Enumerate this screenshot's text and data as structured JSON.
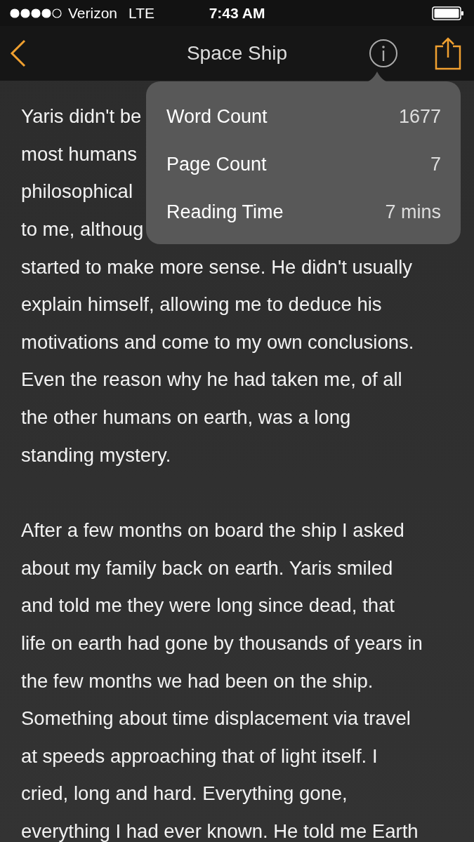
{
  "status_bar": {
    "carrier": "Verizon",
    "network": "LTE",
    "time": "7:43 AM"
  },
  "nav_bar": {
    "title": "Space Ship"
  },
  "info_popover": {
    "rows": [
      {
        "label": "Word Count",
        "value": "1677"
      },
      {
        "label": "Page Count",
        "value": "7"
      },
      {
        "label": "Reading Time",
        "value": "7 mins"
      }
    ]
  },
  "paragraphs": [
    {
      "lines": [
        "Yaris didn't be",
        "most humans",
        "philosophical",
        "to me, althoug",
        "started to make more sense. He didn't usually",
        "explain himself, allowing me to deduce his",
        "motivations and come to my own conclusions.",
        "Even the reason why he had taken me, of all",
        "the other humans on earth, was a long",
        "standing mystery."
      ]
    },
    {
      "lines": [
        "After a few months on board the ship I asked",
        "about my family back on earth. Yaris smiled",
        "and told me they were long since dead, that",
        "life on earth had gone by thousands of years in",
        "the few months we had been on the ship.",
        "Something about time displacement via travel",
        "at speeds approaching that of light itself. I",
        "cried, long and hard. Everything gone,",
        "everything I had ever known. He told me Earth"
      ]
    }
  ]
}
